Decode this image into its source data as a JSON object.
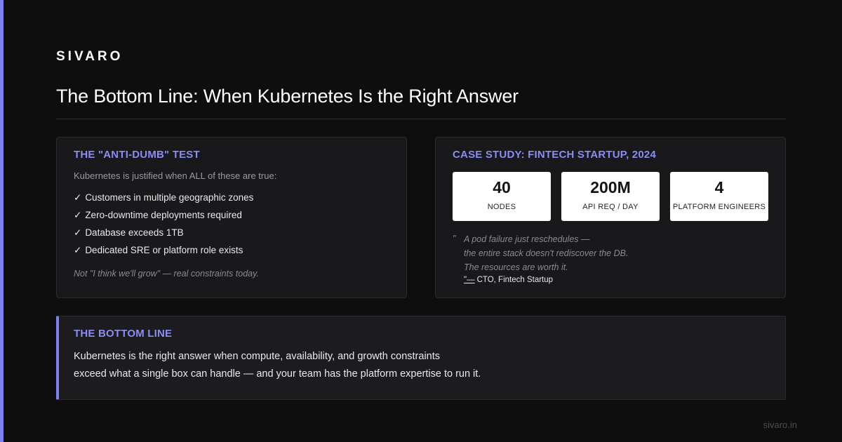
{
  "brand": "SIVARO",
  "title": "The Bottom Line: When Kubernetes Is the Right Answer",
  "anti_dumb": {
    "heading": "THE \"ANTI-DUMB\" TEST",
    "intro": "Kubernetes is justified when ALL of these are true:",
    "check_glyph": "✓",
    "items": [
      "Customers in multiple geographic zones",
      "Zero-downtime deployments required",
      "Database exceeds 1TB",
      "Dedicated SRE or platform role exists"
    ],
    "footnote": "Not \"I think we'll grow\" — real constraints today."
  },
  "case_study": {
    "heading": "CASE STUDY: FINTECH STARTUP, 2024",
    "stats": [
      {
        "value": "40",
        "label": "NODES"
      },
      {
        "value": "200M",
        "label": "API REQ / DAY"
      },
      {
        "value": "4",
        "label": "PLATFORM ENGINEERS"
      }
    ],
    "quote_mark": "\"",
    "quote_lines": [
      "A pod failure just reschedules —",
      "the entire stack doesn't rediscover the DB.",
      "The resources are worth it."
    ],
    "attribution_dash": "\"—",
    "attribution": "CTO, Fintech Startup"
  },
  "bottom_line": {
    "heading": "THE BOTTOM LINE",
    "line1": "Kubernetes is the right answer when compute, availability, and growth constraints",
    "line2": "exceed what a single box can handle — and your team has the platform expertise to run it."
  },
  "site": "sivaro.in",
  "colors": {
    "accent": "#7c80f0",
    "background": "#0e0e0f",
    "card": "#19191b"
  }
}
